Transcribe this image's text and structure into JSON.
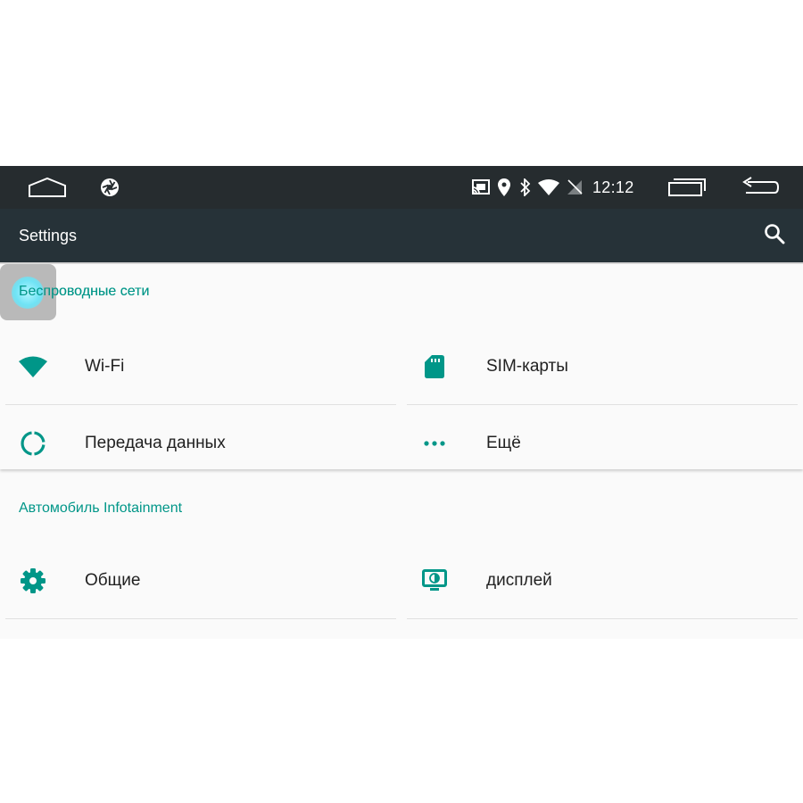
{
  "status_bar": {
    "time": "12:12",
    "icons": [
      "home-icon",
      "aperture-icon",
      "cast-icon",
      "location-icon",
      "bluetooth-icon",
      "wifi-signal-icon",
      "no-sim-icon",
      "recents-icon",
      "back-icon"
    ]
  },
  "toolbar": {
    "title": "Settings",
    "search_icon": "search-icon"
  },
  "sections": [
    {
      "title": "Беспроводные сети",
      "items": [
        {
          "label": "Wi-Fi",
          "icon": "wifi-icon"
        },
        {
          "label": "SIM-карты",
          "icon": "sim-card-icon"
        },
        {
          "label": "Передача данных",
          "icon": "data-usage-icon"
        },
        {
          "label": "Ещё",
          "icon": "more-icon"
        }
      ]
    },
    {
      "title": "Автомобиль Infotainment",
      "items": [
        {
          "label": "Общие",
          "icon": "gear-icon"
        },
        {
          "label": "дисплей",
          "icon": "display-icon"
        }
      ]
    }
  ],
  "colors": {
    "accent": "#009688",
    "toolbar": "#263238",
    "status_bar": "#262c2f",
    "text": "#212121",
    "divider": "#e0e0e0"
  }
}
